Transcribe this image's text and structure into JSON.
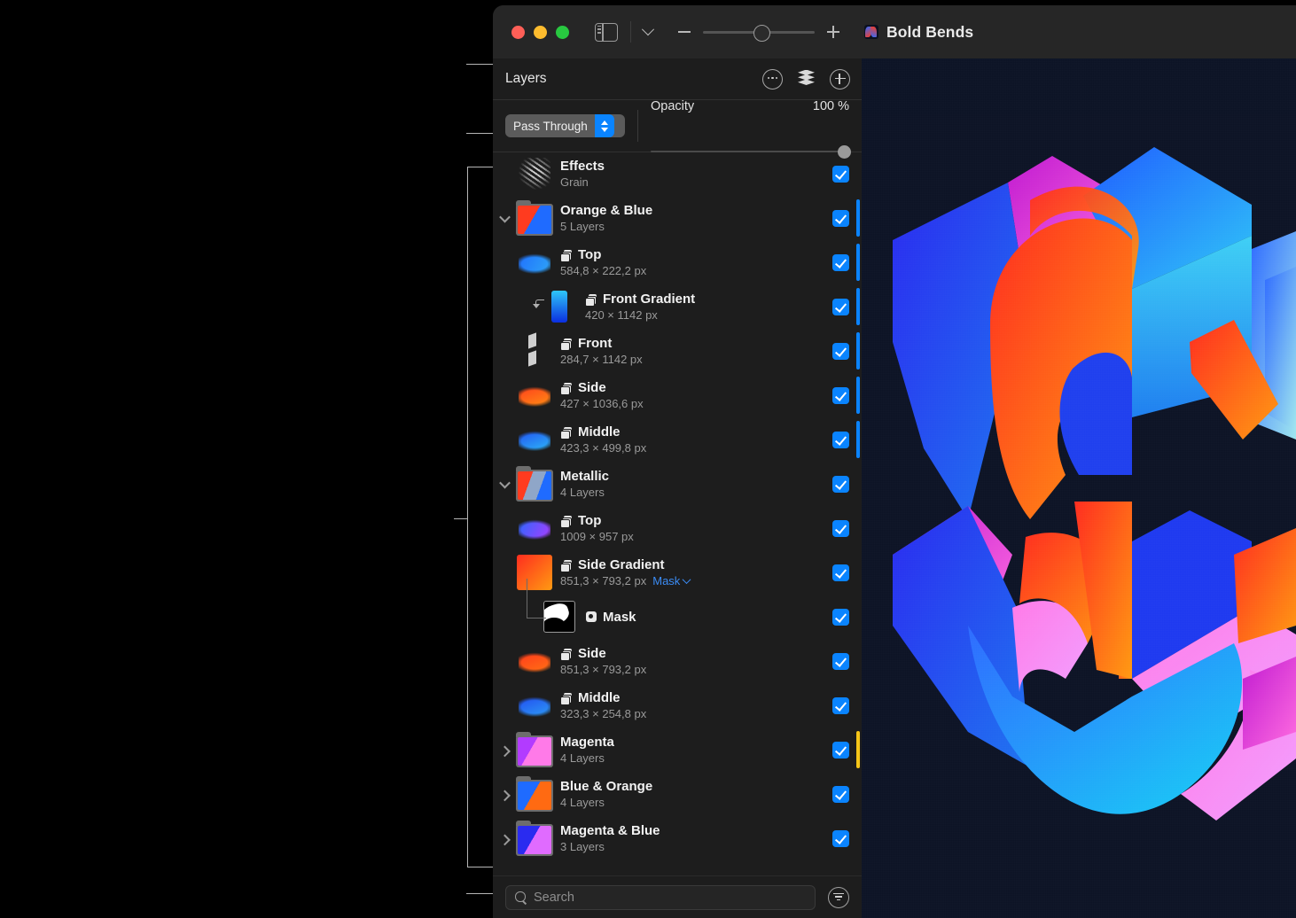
{
  "window": {
    "title": "Bold Bends",
    "traffic_lights": [
      "close",
      "minimize",
      "zoom"
    ],
    "zoom": {
      "minus": "−",
      "plus": "+",
      "value": 50
    }
  },
  "panel": {
    "title": "Layers",
    "header_icons": [
      "more-options-icon",
      "layers-stack-icon",
      "add-layer-icon"
    ],
    "blend_mode": "Pass Through",
    "opacity_label": "Opacity",
    "opacity_value": "100 %"
  },
  "layers": [
    {
      "name": "Effects",
      "sub": "Grain",
      "kind": "effects",
      "depth": 0,
      "disclosure": "none",
      "visible": true,
      "bar": "none",
      "glyph": "none"
    },
    {
      "name": "Orange & Blue",
      "sub": "5 Layers",
      "kind": "group",
      "depth": 0,
      "disclosure": "down",
      "visible": true,
      "bar": "blue",
      "glyph": "none"
    },
    {
      "name": "Top",
      "sub": "584,8 × 222,2 px",
      "kind": "layer",
      "depth": 1,
      "disclosure": "none",
      "visible": true,
      "bar": "blue",
      "glyph": "layers"
    },
    {
      "name": "Front Gradient",
      "sub": "420 × 1142 px",
      "kind": "layer",
      "depth": 2,
      "disclosure": "none",
      "visible": true,
      "bar": "blue",
      "glyph": "layers",
      "clipped": true
    },
    {
      "name": "Front",
      "sub": "284,7 × 1142 px",
      "kind": "layer",
      "depth": 1,
      "disclosure": "none",
      "visible": true,
      "bar": "blue",
      "glyph": "layers"
    },
    {
      "name": "Side",
      "sub": "427 × 1036,6 px",
      "kind": "layer",
      "depth": 1,
      "disclosure": "none",
      "visible": true,
      "bar": "blue",
      "glyph": "layers"
    },
    {
      "name": "Middle",
      "sub": "423,3 × 499,8 px",
      "kind": "layer",
      "depth": 1,
      "disclosure": "none",
      "visible": true,
      "bar": "blue",
      "glyph": "layers"
    },
    {
      "name": "Metallic",
      "sub": "4 Layers",
      "kind": "group",
      "depth": 0,
      "disclosure": "down",
      "visible": true,
      "bar": "none",
      "glyph": "none"
    },
    {
      "name": "Top",
      "sub": "1009 × 957 px",
      "kind": "layer",
      "depth": 1,
      "disclosure": "none",
      "visible": true,
      "bar": "none",
      "glyph": "layers"
    },
    {
      "name": "Side Gradient",
      "sub": "851,3 × 793,2 px",
      "kind": "layer",
      "depth": 1,
      "disclosure": "none",
      "visible": true,
      "bar": "none",
      "glyph": "layers",
      "mask_link": "Mask"
    },
    {
      "name": "Mask",
      "sub": "",
      "kind": "mask",
      "depth": 2,
      "disclosure": "none",
      "visible": true,
      "bar": "none",
      "glyph": "mask"
    },
    {
      "name": "Side",
      "sub": "851,3 × 793,2 px",
      "kind": "layer",
      "depth": 1,
      "disclosure": "none",
      "visible": true,
      "bar": "none",
      "glyph": "layers"
    },
    {
      "name": "Middle",
      "sub": "323,3 × 254,8 px",
      "kind": "layer",
      "depth": 1,
      "disclosure": "none",
      "visible": true,
      "bar": "none",
      "glyph": "layers"
    },
    {
      "name": "Magenta",
      "sub": "4 Layers",
      "kind": "group",
      "depth": 0,
      "disclosure": "right",
      "visible": true,
      "bar": "yellow",
      "glyph": "none"
    },
    {
      "name": "Blue & Orange",
      "sub": "4 Layers",
      "kind": "group",
      "depth": 0,
      "disclosure": "right",
      "visible": true,
      "bar": "none",
      "glyph": "none"
    },
    {
      "name": "Magenta & Blue",
      "sub": "3 Layers",
      "kind": "group",
      "depth": 0,
      "disclosure": "right",
      "visible": true,
      "bar": "none",
      "glyph": "none"
    }
  ],
  "search": {
    "placeholder": "Search",
    "value": "",
    "filter_icon": "filter-icon"
  },
  "colors": {
    "accent_blue": "#0a84ff",
    "marker_blue": "#0a84ff",
    "marker_yellow": "#f5c518",
    "panel_bg": "#1d1d1d",
    "canvas_bg": "#0d1426",
    "mask_link": "#3b8cf5"
  }
}
